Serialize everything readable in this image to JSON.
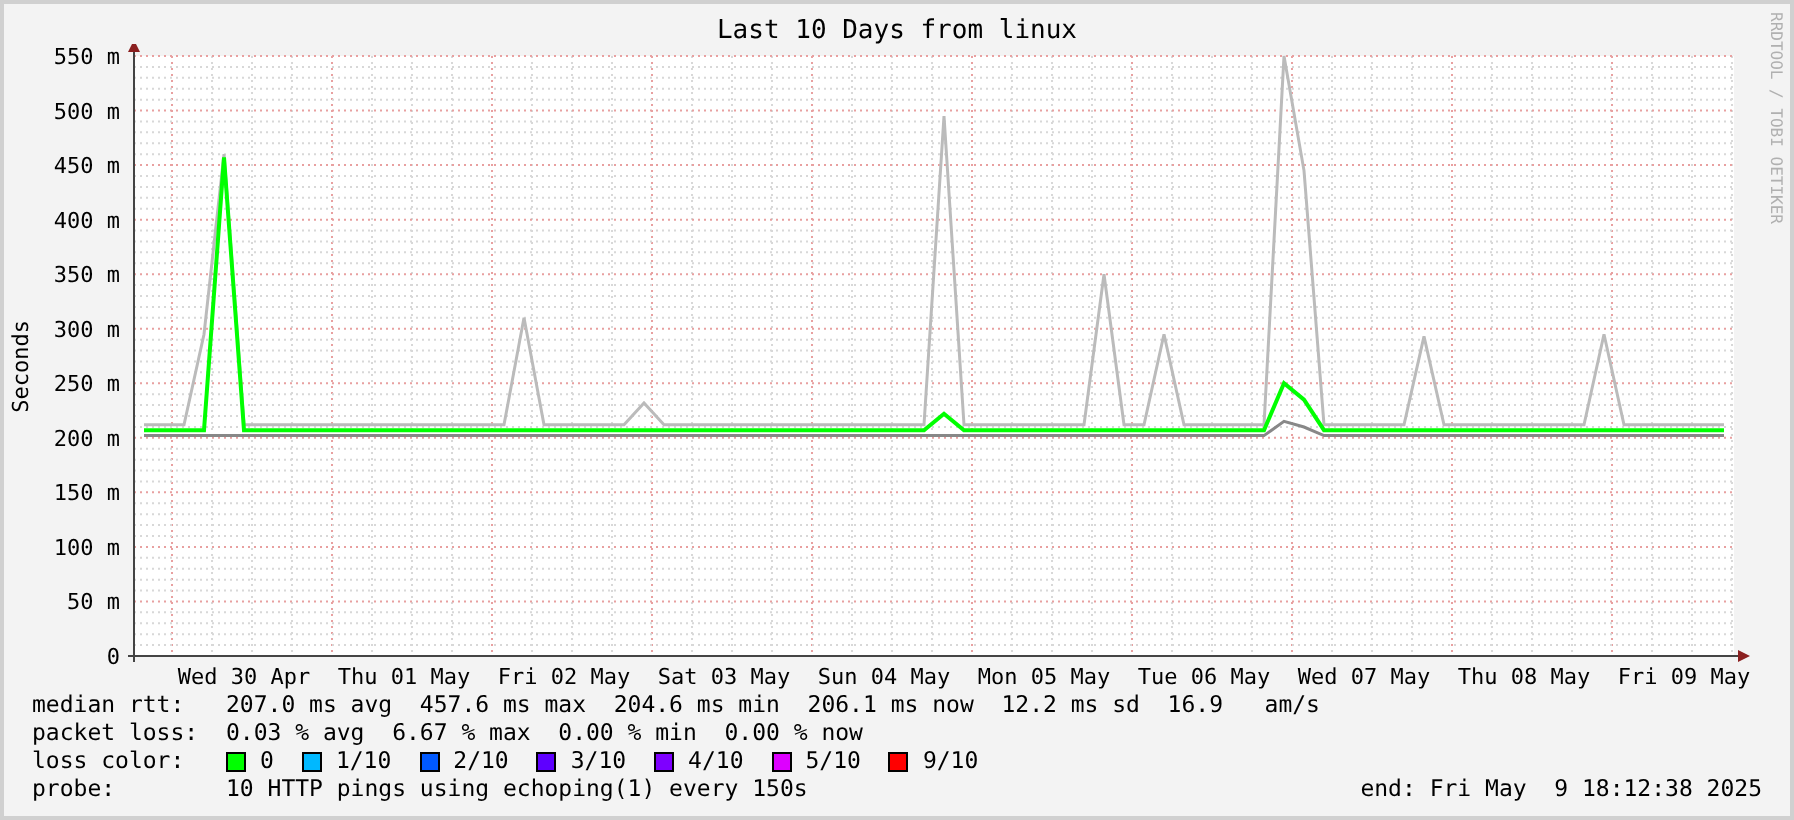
{
  "title": "Last 10 Days from linux",
  "credit": "RRDTOOL / TOBI OETIKER",
  "chart_data": {
    "type": "line",
    "ylabel": "Seconds",
    "grid": true,
    "ylim": [
      0,
      550
    ],
    "yticks": [
      {
        "value": 0,
        "label": "0"
      },
      {
        "value": 50,
        "label": "50 m"
      },
      {
        "value": 100,
        "label": "100 m"
      },
      {
        "value": 150,
        "label": "150 m"
      },
      {
        "value": 200,
        "label": "200 m"
      },
      {
        "value": 250,
        "label": "250 m"
      },
      {
        "value": 300,
        "label": "300 m"
      },
      {
        "value": 350,
        "label": "350 m"
      },
      {
        "value": 400,
        "label": "400 m"
      },
      {
        "value": 450,
        "label": "450 m"
      },
      {
        "value": 500,
        "label": "500 m"
      },
      {
        "value": 550,
        "label": "550 m"
      }
    ],
    "categories": [
      null,
      null,
      null,
      null,
      null,
      "Wed 30 Apr",
      null,
      null,
      null,
      null,
      null,
      null,
      null,
      "Thu 01 May",
      null,
      null,
      null,
      null,
      null,
      null,
      null,
      "Fri 02 May",
      null,
      null,
      null,
      null,
      null,
      null,
      null,
      "Sat 03 May",
      null,
      null,
      null,
      null,
      null,
      null,
      null,
      "Sun 04 May",
      null,
      null,
      null,
      null,
      null,
      null,
      null,
      "Mon 05 May",
      null,
      null,
      null,
      null,
      null,
      null,
      null,
      "Tue 06 May",
      null,
      null,
      null,
      null,
      null,
      null,
      null,
      "Wed 07 May",
      null,
      null,
      null,
      null,
      null,
      null,
      null,
      "Thu 08 May",
      null,
      null,
      null,
      null,
      null,
      null,
      null,
      "Fri 09 May",
      null,
      null
    ],
    "series": [
      {
        "color": "#bbbbbb",
        "values": [
          212,
          212,
          212,
          295,
          460,
          212,
          212,
          212,
          212,
          212,
          212,
          212,
          212,
          212,
          212,
          212,
          212,
          212,
          212,
          310,
          212,
          212,
          212,
          212,
          212,
          232,
          212,
          212,
          212,
          212,
          212,
          212,
          212,
          212,
          212,
          212,
          212,
          212,
          212,
          212,
          495,
          212,
          212,
          212,
          212,
          212,
          212,
          212,
          350,
          212,
          212,
          295,
          212,
          212,
          212,
          212,
          212,
          550,
          445,
          212,
          212,
          212,
          212,
          212,
          293,
          212,
          212,
          212,
          212,
          212,
          212,
          212,
          212,
          295,
          212,
          212,
          212,
          212,
          212,
          212
        ]
      },
      {
        "color": "#888888",
        "values": [
          202,
          202,
          202,
          202,
          202,
          202,
          202,
          202,
          202,
          202,
          202,
          202,
          202,
          202,
          202,
          202,
          202,
          202,
          202,
          202,
          202,
          202,
          202,
          202,
          202,
          202,
          202,
          202,
          202,
          202,
          202,
          202,
          202,
          202,
          202,
          202,
          202,
          202,
          202,
          202,
          202,
          202,
          202,
          202,
          202,
          202,
          202,
          202,
          202,
          202,
          202,
          202,
          202,
          202,
          202,
          202,
          202,
          215,
          210,
          202,
          202,
          202,
          202,
          202,
          202,
          202,
          202,
          202,
          202,
          202,
          202,
          202,
          202,
          202,
          202,
          202,
          202,
          202,
          202,
          202
        ]
      },
      {
        "color": "#00ff00",
        "values": [
          207,
          207,
          207,
          207,
          457,
          207,
          207,
          207,
          207,
          207,
          207,
          207,
          207,
          207,
          207,
          207,
          207,
          207,
          207,
          207,
          207,
          207,
          207,
          207,
          207,
          207,
          207,
          207,
          207,
          207,
          207,
          207,
          207,
          207,
          207,
          207,
          207,
          207,
          207,
          207,
          222,
          207,
          207,
          207,
          207,
          207,
          207,
          207,
          207,
          207,
          207,
          207,
          207,
          207,
          207,
          207,
          207,
          250,
          235,
          207,
          207,
          207,
          207,
          207,
          207,
          207,
          207,
          207,
          207,
          207,
          207,
          207,
          207,
          207,
          207,
          207,
          207,
          207,
          207,
          207
        ]
      }
    ]
  },
  "legend": [
    {
      "kind": "stats",
      "label": "median rtt:",
      "text": "207.0 ms avg  457.6 ms max  204.6 ms min  206.1 ms now  12.2 ms sd  16.9   am/s"
    },
    {
      "kind": "stats",
      "label": "packet loss:",
      "text": "0.03 % avg  6.67 % max  0.00 % min  0.00 % now"
    },
    {
      "kind": "colors",
      "label": "loss color:",
      "items": [
        {
          "label": "0",
          "color": "#00ff00"
        },
        {
          "label": "1/10",
          "color": "#00b8ff"
        },
        {
          "label": "2/10",
          "color": "#0059ff"
        },
        {
          "label": "3/10",
          "color": "#5e00ff"
        },
        {
          "label": "4/10",
          "color": "#7e00ff"
        },
        {
          "label": "5/10",
          "color": "#dd00ff"
        },
        {
          "label": "9/10",
          "color": "#ff0000"
        }
      ]
    },
    {
      "kind": "probe",
      "label": "probe:",
      "text": "10 HTTP pings using echoping(1) every 150s",
      "end": "end: Fri May  9 18:12:38 2025"
    }
  ]
}
